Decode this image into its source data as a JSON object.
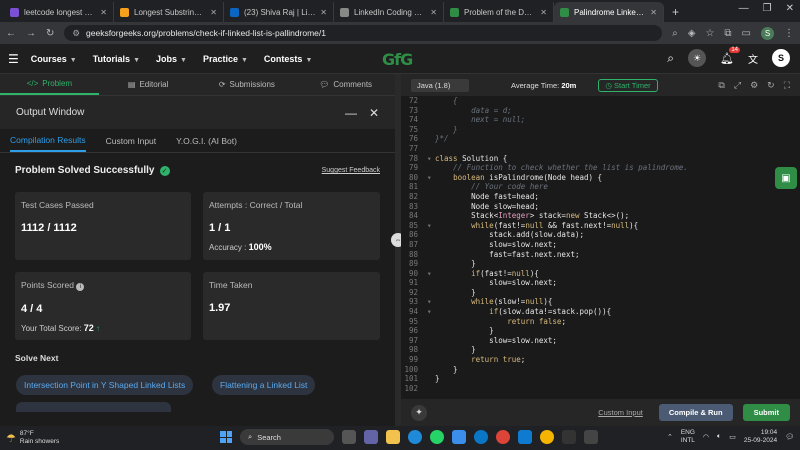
{
  "browser": {
    "tabs": [
      {
        "title": "leetcode longest substring",
        "color": "#7b4fd6"
      },
      {
        "title": "Longest Substring Without",
        "color": "#f89f1b"
      },
      {
        "title": "(23) Shiva Raj | LinkedIn",
        "color": "#0a66c2"
      },
      {
        "title": "LinkedIn Coding Challenge",
        "color": "#888888"
      },
      {
        "title": "Problem of the Day | Geek",
        "color": "#2f8d46"
      },
      {
        "title": "Palindrome Linked List | P",
        "color": "#2f8d46"
      }
    ],
    "url": "geeksforgeeks.org/problems/check-if-linked-list-is-pallindrome/1",
    "profile_initial": "S"
  },
  "nav": {
    "items": [
      "Courses",
      "Tutorials",
      "Jobs",
      "Practice",
      "Contests"
    ],
    "logo": "GfG",
    "notif_count": "14",
    "user_initial": "S"
  },
  "problem_tabs": [
    "Problem",
    "Editorial",
    "Submissions",
    "Comments"
  ],
  "output": {
    "title": "Output Window",
    "tabs": [
      "Compilation Results",
      "Custom Input",
      "Y.O.G.I. (AI Bot)"
    ],
    "status": "Problem Solved Successfully",
    "feedback": "Suggest Feedback",
    "cards": {
      "test_cases_label": "Test Cases Passed",
      "test_cases_value": "1112 / 1112",
      "attempts_label": "Attempts : Correct / Total",
      "attempts_value": "1 / 1",
      "accuracy_label": "Accuracy :",
      "accuracy_value": "100%",
      "points_label": "Points Scored",
      "points_value": "4 / 4",
      "total_score_label": "Your Total Score:",
      "total_score_value": "72",
      "time_label": "Time Taken",
      "time_value": "1.97"
    },
    "solve_next_label": "Solve Next",
    "solve_next": [
      "Intersection Point in Y Shaped Linked Lists",
      "Flattening a Linked List"
    ]
  },
  "editor": {
    "language": "Java (1.8)",
    "avg_time_label": "Average Time:",
    "avg_time_value": "20m",
    "timer_label": "Start Timer",
    "custom_input": "Custom Input",
    "compile_run": "Compile & Run",
    "submit": "Submit"
  },
  "taskbar": {
    "temperature": "87°F",
    "weather": "Rain showers",
    "search": "Search",
    "lang": "ENG",
    "region": "INTL",
    "time": "19:04",
    "date": "25-09-2024"
  }
}
